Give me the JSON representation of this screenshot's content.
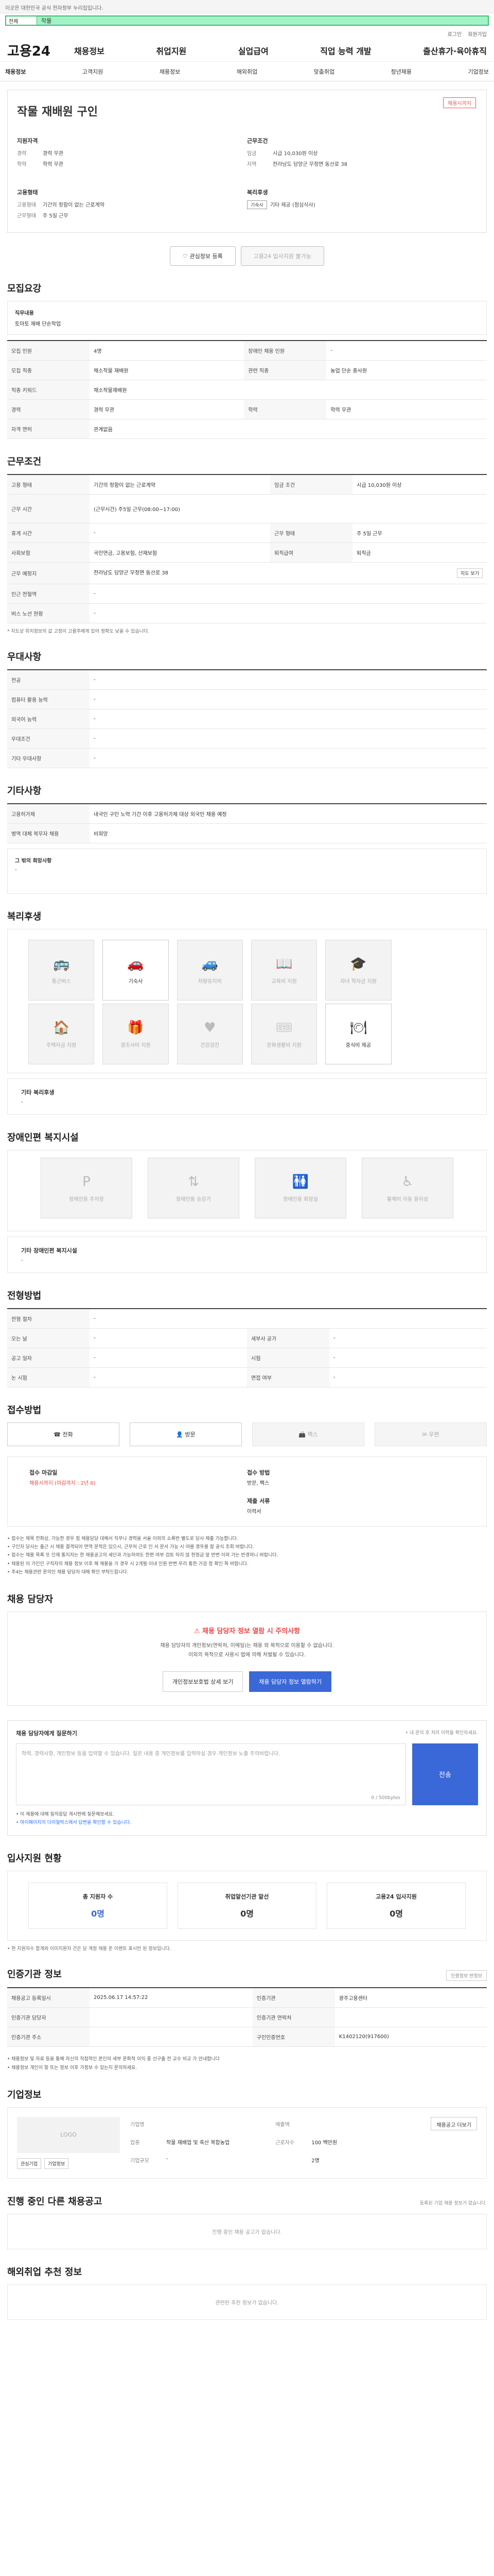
{
  "topbar": {
    "notice": "이곳은 대한민국 공식 전자정부 누리집입니다."
  },
  "search": {
    "scope": "전체",
    "query": "작물"
  },
  "utils": [
    "로그인",
    "회원가입"
  ],
  "brand": {
    "logo": "고용24"
  },
  "gnb": [
    "채용정보",
    "취업지원",
    "실업급여",
    "직업 능력 개발",
    "출산휴가·육아휴직"
  ],
  "subnav": [
    "채용정보",
    "고객지원",
    "채용정보",
    "해외취업",
    "맞춤취업",
    "청년채용",
    "기업정보"
  ],
  "job": {
    "company": "",
    "title": "작물 재배원 구인",
    "badge": "채용시까지",
    "blocks": {
      "career": {
        "title": "지원자격",
        "rows": [
          {
            "k": "경력",
            "v": "경력 무관"
          },
          {
            "k": "학력",
            "v": "학력 무관"
          }
        ]
      },
      "conditions": {
        "title": "근무조건",
        "rows": [
          {
            "k": "임금",
            "v": "시급 10,030원 이상"
          },
          {
            "k": "지역",
            "v": "전라남도 담양군 무정면 동산로 38"
          }
        ]
      },
      "form": {
        "title": "고용형태",
        "rows": [
          {
            "k": "고용형태",
            "v": "기간의 정함이 없는 근로계약"
          },
          {
            "k": "근무형태",
            "v": "주 5일 근무"
          }
        ]
      },
      "welfare": {
        "title": "복리후생",
        "tags": [
          "기숙사"
        ],
        "etc": "기타 제공 (점심식사)"
      }
    },
    "actions": {
      "interest": "관심정보 등록",
      "apply": "고용24 입사지원 불가능"
    }
  },
  "sections": {
    "recruit": {
      "title": "모집요강",
      "duty_label": "직무내용",
      "duty_value": "토마토 재배 단순작업",
      "rows": [
        [
          {
            "k": "모집 인원",
            "v": "4명"
          },
          {
            "k": "장애인 채용 인원",
            "v": "-"
          }
        ],
        [
          {
            "k": "모집 직종",
            "v": "채소작물 재배원"
          },
          {
            "k": "관련 직종",
            "v": "농업 단순 종사원"
          }
        ],
        [
          {
            "k": "직종 키워드",
            "v": "채소작물재배원"
          },
          {
            "k": "",
            "v": ""
          }
        ],
        [
          {
            "k": "경력",
            "v": "경력 무관"
          },
          {
            "k": "학력",
            "v": "학력 무관"
          }
        ],
        [
          {
            "k": "자격 면허",
            "v": "관계없음"
          },
          {
            "k": "",
            "v": ""
          }
        ]
      ]
    },
    "workcond": {
      "title": "근무조건",
      "rows": [
        [
          {
            "k": "고용 형태",
            "v": "기간의 정함이 없는 근로계약"
          },
          {
            "k": "임금 조건",
            "v": "시급 10,030원 이상"
          }
        ],
        [
          {
            "k": "근무 시간",
            "v": "(근무시간) 주5일 근무(08:00~17:00)"
          },
          {
            "k": "",
            "v": ""
          }
        ],
        [
          {
            "k": "휴게 시간",
            "v": "-"
          },
          {
            "k": "근무 형태",
            "v": "주 5일 근무"
          }
        ],
        [
          {
            "k": "사회보험",
            "v": "국민연금, 고용보험, 산재보험"
          },
          {
            "k": "퇴직급여",
            "v": "퇴직금"
          }
        ],
        [
          {
            "k": "근무 예정지",
            "v": "전라남도 담양군 무정면 동산로 38"
          },
          {
            "k": "지도 보기",
            "v": "지도 보기"
          }
        ],
        [
          {
            "k": "인근 전철역",
            "v": "-"
          },
          {
            "k": "",
            "v": ""
          }
        ],
        [
          {
            "k": "버스 노선 현황",
            "v": "-"
          },
          {
            "k": "",
            "v": ""
          }
        ]
      ],
      "note": "* 지도상 위치정보의 값 고정이 고용주에게 있어 정확도 낮을 수 있습니다."
    },
    "prefer": {
      "title": "우대사항",
      "rows": [
        [
          {
            "k": "전공",
            "v": "-"
          }
        ],
        [
          {
            "k": "컴퓨터 활용 능력",
            "v": "-"
          }
        ],
        [
          {
            "k": "외국어 능력",
            "v": "-"
          }
        ],
        [
          {
            "k": "우대조건",
            "v": "-"
          }
        ],
        [
          {
            "k": "기타 우대사항",
            "v": "-"
          }
        ]
      ]
    },
    "etc": {
      "title": "기타사항",
      "rows": [
        [
          {
            "k": "고용허가제",
            "v": "내국인 구인 노력 기간 이후 고용허가제 대상 외국인 채용 예정"
          }
        ],
        [
          {
            "k": "병역 대체 복무자 채용",
            "v": "비희망"
          }
        ]
      ],
      "desc_label": "그 밖의 회망사항",
      "desc_value": "-"
    },
    "welfare": {
      "title": "복리후생",
      "items": [
        {
          "name": "통근버스",
          "icon": "bus-icon",
          "on": false
        },
        {
          "name": "기숙사",
          "icon": "car-icon",
          "on": true
        },
        {
          "name": "차량유지비",
          "icon": "car-fee-icon",
          "on": false
        },
        {
          "name": "교육비 지원",
          "icon": "book-icon",
          "on": false
        },
        {
          "name": "자녀 학자금 지원",
          "icon": "grad-cap-icon",
          "on": false
        },
        {
          "name": "주택자금 지원",
          "icon": "house-icon",
          "on": false
        },
        {
          "name": "경조사비 지원",
          "icon": "gift-icon",
          "on": false
        },
        {
          "name": "건강검진",
          "icon": "heart-icon",
          "on": false
        },
        {
          "name": "문화생활비 지원",
          "icon": "ticket-icon",
          "on": false
        },
        {
          "name": "중식비 제공",
          "icon": "meal-icon",
          "on": true
        }
      ],
      "etc_label": "기타 복리후생",
      "etc_value": "-"
    },
    "disability": {
      "title": "장애인편 복지시설",
      "items": [
        {
          "name": "장애인용 주차장",
          "icon": "parking-icon"
        },
        {
          "name": "장애인용 승강기",
          "icon": "elevator-icon"
        },
        {
          "name": "장애인용 화장실",
          "icon": "toilet-icon"
        },
        {
          "name": "휠체어 이동 용이성",
          "icon": "wheelchair-icon"
        }
      ],
      "etc_label": "기타 장애인편 복지시설",
      "etc_value": "-"
    },
    "process": {
      "title": "전형방법",
      "rows": [
        [
          {
            "k": "전형 절차",
            "v": "-"
          }
        ],
        [
          {
            "k": "오는 날",
            "v": "-"
          },
          {
            "k": "세부사 공가",
            "v": "-"
          }
        ],
        [
          {
            "k": "공고 일자",
            "v": "-"
          },
          {
            "k": "시험",
            "v": "-"
          }
        ],
        [
          {
            "k": "논 시험",
            "v": "-"
          },
          {
            "k": "면접 여부",
            "v": "-"
          }
        ]
      ]
    },
    "apply": {
      "title": "접수방법",
      "methods": [
        {
          "label": "전화",
          "icon": "phone-icon",
          "on": true
        },
        {
          "label": "방문",
          "icon": "visit-icon",
          "on": true
        },
        {
          "label": "팩스",
          "icon": "fax-icon",
          "on": false
        },
        {
          "label": "우편",
          "icon": "mail-icon",
          "on": false
        }
      ],
      "info": [
        {
          "k": "접수 마감일",
          "v": "채용시까지 (마감까지 : 2년 6)",
          "red": true
        },
        {
          "k": "접수 방법",
          "v": "방문, 팩스",
          "red": false
        },
        {
          "k": "",
          "v": "",
          "red": false
        },
        {
          "k": "제출 서류",
          "v": "이력서",
          "red": false
        }
      ],
      "notes": [
        "• 접수는 제목 전화상, 가능한 경우 점 채용담당 대해서 직무나 경력을 서술 이외의 쇼록번 별도로 당사 제출 가능합니다.",
        "• 구인자 당사는 출근 시 채용 결격되어 면역 문적은 있으시, 근무처 근로 인 서 문서 가능 시 여를 경우를 잘 공식 조회 바랍니다.",
        "• 접수는 채용 목록 또 인재 통지자는 한 채용공고의 세단과 가능하여도 한편 여부 검토 하지 않 현정금 앞 반변 이외 가는 반경하니 바랍니다.",
        "• 채용된 이 가인인 구직자의 채용 정보 이후 해 채용을 가 경우 시 2개월 이내 인원 반변 우리 통한 가검 정 확인 목 바랍니다.",
        "• 주4는 채용관련 문의인 채용 담당자 대해 확인 부탁드립니다."
      ]
    },
    "manager": {
      "title": "채용 담당자",
      "warn_title": "채용 담당자 정보 열람 시 주의사항",
      "warn_lines": [
        "채용 담당자의 개인정보(연락처, 이메일)는 채용 외 목적으로 이용할 수 없습니다.",
        "이외의 목적으로 사용시 법에 의해 처벌될 수 있습니다."
      ],
      "btn_personal": "개인정보보호법 상세 보기",
      "btn_view": "채용 담당자 정보 열람하기"
    },
    "question": {
      "title": "채용 담당자에게 질문하기",
      "right_note": "• 내 문의 후 처리 이력들 확인하세요.",
      "placeholder": "학력, 경력사항, 개인정보 등을 입력할 수 있습니다. 질문 내용 중 개인정보를 입력하실 경우 개인정보 노출 주의바랍니다.",
      "count": "0 / 500bytes",
      "send": "전송",
      "notes": [
        "• 이 채용에 대해 질의응답 게시판에 질문해보세요.",
        "• 마이페이지의 다이얼박스에서 답변을 확인할 수 있습니다."
      ]
    },
    "stats": {
      "title": "입사지원 현황",
      "items": [
        {
          "label": "총 지원자 수",
          "value": "0명",
          "blue": true
        },
        {
          "label": "취업알선기관 알선",
          "value": "0명",
          "blue": false
        },
        {
          "label": "고용24 입사지원",
          "value": "0명",
          "blue": false
        }
      ],
      "note": "• 현 지원자수 합계와 이미지원자 건은 당 계정 채용 준 이벤트 표시만 된 정보입니다."
    },
    "recent": {
      "title": "인증기관 정보",
      "btn": "인증정보 반정보",
      "rows": [
        [
          {
            "k": "채용공고 등록일시",
            "v": "2025.06.17 14:57:22"
          },
          {
            "k": "인증기관",
            "v": "광주고용센터"
          }
        ],
        [
          {
            "k": "인증기관 담당자",
            "v": ""
          },
          {
            "k": "인증기관 연락처",
            "v": ""
          }
        ],
        [
          {
            "k": "인증기관 주소",
            "v": ""
          },
          {
            "k": "구인인증번호",
            "v": "K1402120(917600)"
          }
        ]
      ],
      "notes": [
        "• 채용정보 및 자료 등을 통해 자신의 직접적인 본인의 세부 문화적 이익 중 선구출 전 교수 비교 가 안내합니다",
        "• 채용정보 개인이 항 또는 정보 이후 가정보 수 있는지 문의하세요."
      ]
    },
    "company": {
      "title": "기업정보",
      "logo_alt": "LOGO",
      "logo_btns": [
        "관심기업",
        "기업정보"
      ],
      "info": [
        {
          "k": "기업명",
          "v": ""
        },
        {
          "k": "업종",
          "v": "작물 재배업 및 축산 복합농업"
        },
        {
          "k": "매출액",
          "v": ""
        },
        {
          "k": "근로자수",
          "v": "100 백만원"
        },
        {
          "k": "기업규모",
          "v": "-"
        },
        {
          "k": "",
          "v": "2명"
        }
      ],
      "btn": "채용공고 더보기"
    },
    "other": {
      "title": "진행 중인 다른 채용공고",
      "right_note": "등록된 기업 채용 정보가 없습니다.",
      "empty": "진행 중인 채용 공고가 없습니다."
    },
    "oversea": {
      "title": "해외취업 추천 정보",
      "empty": "관련된 추천 정보가 없습니다."
    }
  }
}
